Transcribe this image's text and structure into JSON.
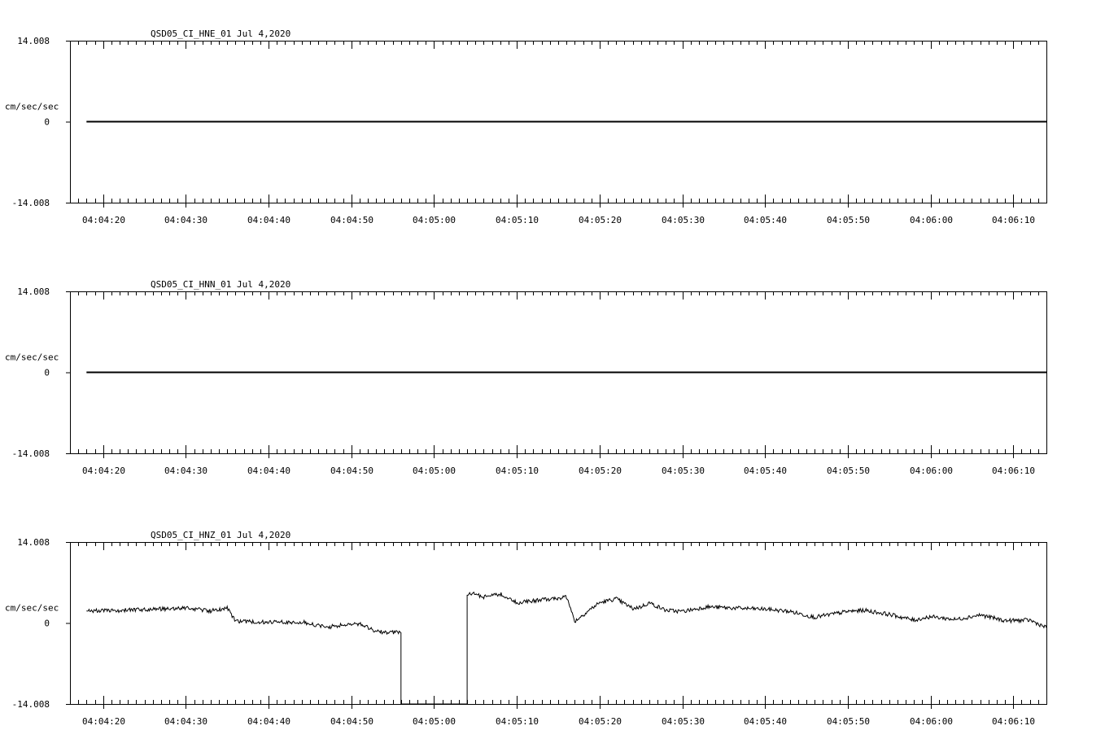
{
  "chart_data": [
    {
      "type": "line",
      "title": "QSD05_CI_HNE_01  Jul 4,2020",
      "ylabel": "cm/sec/sec",
      "ylim": [
        -14.008,
        14.008
      ],
      "y_tick_labels": [
        "14.008",
        "0",
        "-14.008"
      ],
      "xlim": [
        "04:04:16",
        "04:06:14"
      ],
      "x_tick_labels": [
        "04:04:20",
        "04:04:30",
        "04:04:40",
        "04:04:50",
        "04:05:00",
        "04:05:10",
        "04:05:20",
        "04:05:30",
        "04:05:40",
        "04:05:50",
        "04:06:00",
        "04:06:10"
      ],
      "series": [
        {
          "x": [
            "04:04:18",
            "04:06:14"
          ],
          "values": [
            0,
            0
          ]
        }
      ]
    },
    {
      "type": "line",
      "title": "QSD05_CI_HNN_01  Jul 4,2020",
      "ylabel": "cm/sec/sec",
      "ylim": [
        -14.008,
        14.008
      ],
      "y_tick_labels": [
        "14.008",
        "0",
        "-14.008"
      ],
      "xlim": [
        "04:04:16",
        "04:06:14"
      ],
      "x_tick_labels": [
        "04:04:20",
        "04:04:30",
        "04:04:40",
        "04:04:50",
        "04:05:00",
        "04:05:10",
        "04:05:20",
        "04:05:30",
        "04:05:40",
        "04:05:50",
        "04:06:00",
        "04:06:10"
      ],
      "series": [
        {
          "x": [
            "04:04:18",
            "04:06:14"
          ],
          "values": [
            0,
            0
          ]
        }
      ]
    },
    {
      "type": "line",
      "title": "QSD05_CI_HNZ_01  Jul 4,2020",
      "ylabel": "cm/sec/sec",
      "ylim": [
        -14.008,
        14.008
      ],
      "y_tick_labels": [
        "14.008",
        "0",
        "-14.008"
      ],
      "xlim": [
        "04:04:16",
        "04:06:14"
      ],
      "x_tick_labels": [
        "04:04:20",
        "04:04:30",
        "04:04:40",
        "04:04:50",
        "04:05:00",
        "04:05:10",
        "04:05:20",
        "04:05:30",
        "04:05:40",
        "04:05:50",
        "04:06:00",
        "04:06:10"
      ],
      "series": [
        {
          "x": [
            "04:04:18",
            "04:04:20",
            "04:04:25",
            "04:04:30",
            "04:04:33",
            "04:04:35",
            "04:04:36",
            "04:04:40",
            "04:04:44",
            "04:04:47",
            "04:04:48",
            "04:04:51",
            "04:04:53",
            "04:04:56",
            "04:04:56",
            "04:04:57",
            "04:04:59",
            "04:05:00",
            "04:05:02",
            "04:05:03",
            "04:05:04",
            "04:05:04",
            "04:05:05",
            "04:05:06",
            "04:05:08",
            "04:05:10",
            "04:05:13",
            "04:05:16",
            "04:05:17",
            "04:05:19",
            "04:05:20",
            "04:05:22",
            "04:05:24",
            "04:05:25",
            "04:05:26",
            "04:05:28",
            "04:05:30",
            "04:05:33",
            "04:05:36",
            "04:05:40",
            "04:05:43",
            "04:05:46",
            "04:05:50",
            "04:05:52",
            "04:05:55",
            "04:05:58",
            "04:06:00",
            "04:06:03",
            "04:06:06",
            "04:06:09",
            "04:06:12",
            "04:06:14"
          ],
          "values": [
            2.2,
            2.1,
            2.3,
            2.6,
            2.1,
            2.6,
            0.3,
            0.1,
            0.2,
            -0.8,
            -0.5,
            -0.1,
            -1.5,
            -1.7,
            -25.0,
            -23.5,
            -24.0,
            -23.5,
            -21.5,
            -20.0,
            -18.0,
            5.0,
            5.0,
            4.5,
            5.0,
            3.5,
            4.0,
            4.5,
            0.3,
            2.5,
            3.5,
            4.2,
            2.5,
            2.8,
            3.5,
            2.2,
            2.0,
            2.8,
            2.6,
            2.4,
            2.0,
            1.0,
            2.0,
            2.2,
            1.5,
            0.5,
            1.1,
            0.6,
            1.4,
            0.4,
            0.5,
            -0.8
          ]
        }
      ]
    }
  ]
}
